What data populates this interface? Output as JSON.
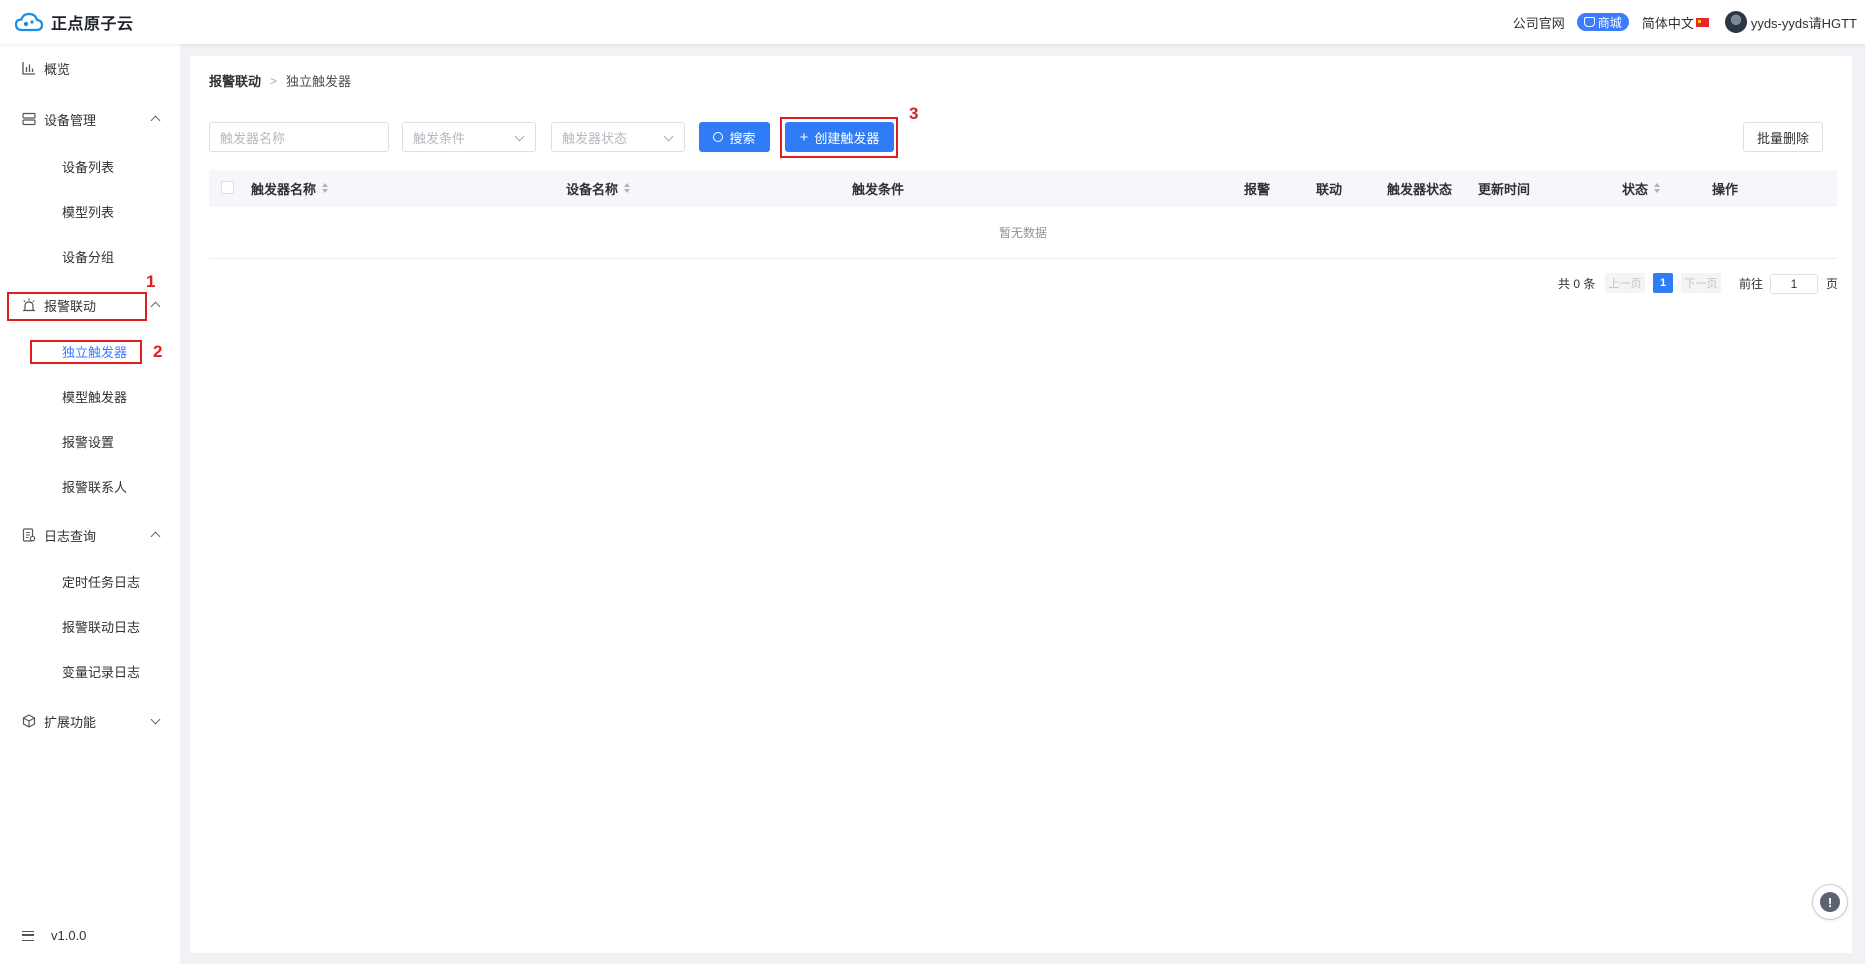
{
  "app": {
    "logo_text": "正点原子云"
  },
  "header": {
    "website_link": "公司官网",
    "mall_label": "商城",
    "language": "简体中文",
    "username": "yyds-yyds请HGTT"
  },
  "sidebar": {
    "overview": "概览",
    "device_mgmt": {
      "label": "设备管理",
      "items": [
        "设备列表",
        "模型列表",
        "设备分组"
      ]
    },
    "alarm_linkage": {
      "label": "报警联动",
      "items": [
        "独立触发器",
        "模型触发器",
        "报警设置",
        "报警联系人"
      ]
    },
    "log_query": {
      "label": "日志查询",
      "items": [
        "定时任务日志",
        "报警联动日志",
        "变量记录日志"
      ]
    },
    "extensions": {
      "label": "扩展功能"
    },
    "version": "v1.0.0"
  },
  "annotations": [
    "1",
    "2",
    "3"
  ],
  "breadcrumb": {
    "parent": "报警联动",
    "current": "独立触发器"
  },
  "filters": {
    "trigger_name_placeholder": "触发器名称",
    "trigger_condition_placeholder": "触发条件",
    "trigger_status_placeholder": "触发器状态"
  },
  "toolbar": {
    "search_label": "搜索",
    "create_label": "创建触发器",
    "batch_delete_label": "批量删除"
  },
  "table": {
    "columns": [
      "触发器名称",
      "设备名称",
      "触发条件",
      "报警",
      "联动",
      "触发器状态",
      "更新时间",
      "状态",
      "操作"
    ],
    "empty_text": "暂无数据"
  },
  "pagination": {
    "total_text": "共 0 条",
    "prev_label": "上一页",
    "current_page": "1",
    "next_label": "下一页",
    "goto_label": "前往",
    "goto_value": "1",
    "page_suffix": "页"
  },
  "colors": {
    "primary": "#2f7cf6",
    "annotation": "#e01e1e"
  },
  "icons": {
    "overview": "bar-chart-icon",
    "device_mgmt": "server-icon",
    "alarm_linkage": "alarm-icon",
    "log_query": "log-icon",
    "extensions": "cube-icon",
    "help": "help-icon"
  }
}
